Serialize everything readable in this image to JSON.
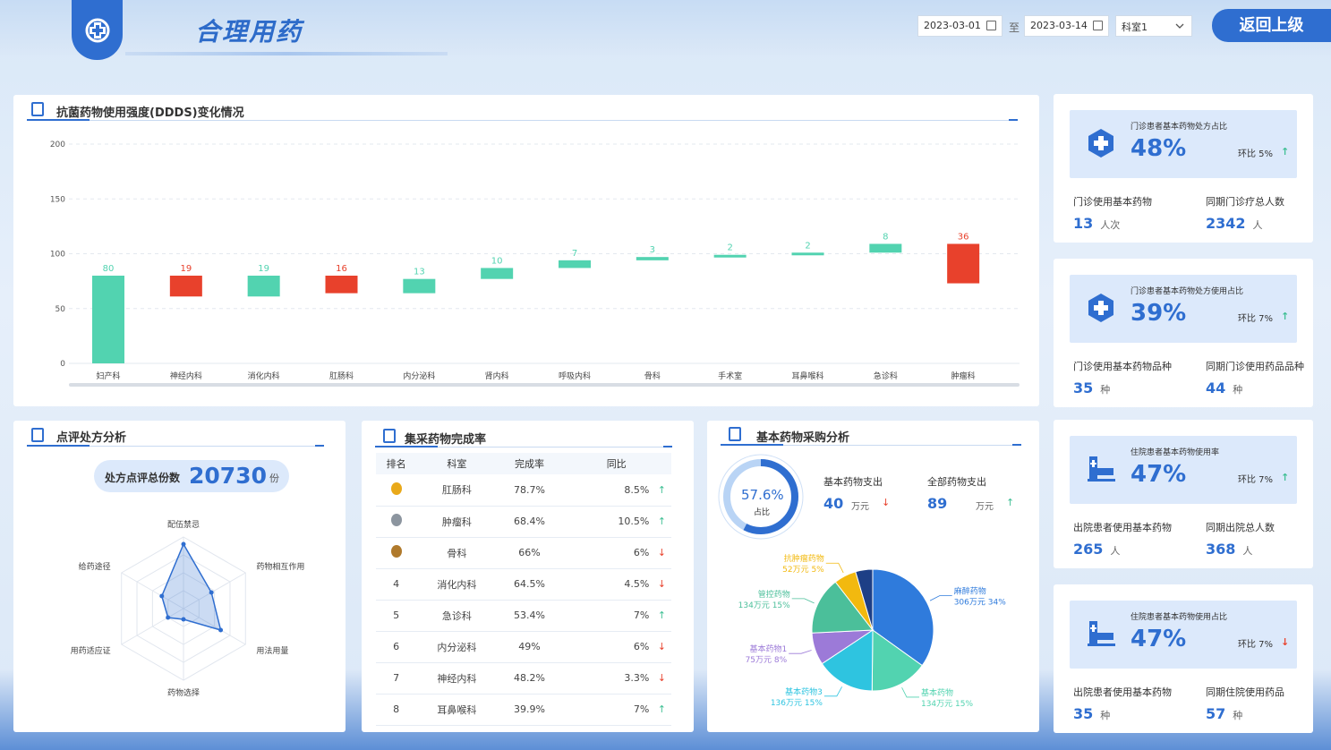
{
  "header": {
    "title": "合理用药",
    "date_start": "2023-03-01",
    "date_sep": "至",
    "date_end": "2023-03-14",
    "dept_select": "科室1",
    "back_label": "返回上级"
  },
  "colors": {
    "primary": "#2f6ed0",
    "up": "#3fbf94",
    "down": "#e8412c"
  },
  "antibiotic": {
    "title": "抗菌药物使用强度(DDDS)变化情况",
    "chart_data": {
      "type": "bar",
      "subtype": "waterfall",
      "categories": [
        "妇产科",
        "神经内科",
        "消化内科",
        "肛肠科",
        "内分泌科",
        "肾内科",
        "呼吸内科",
        "骨科",
        "手术室",
        "耳鼻喉科",
        "急诊科",
        "肿瘤科"
      ],
      "values": [
        80,
        19,
        19,
        16,
        13,
        10,
        7,
        3,
        2,
        2,
        8,
        36
      ],
      "direction": [
        "up",
        "down",
        "up",
        "down",
        "up",
        "up",
        "up",
        "up",
        "up",
        "up",
        "up",
        "down"
      ],
      "ylim": [
        0,
        200
      ],
      "yticks": [
        0,
        50,
        100,
        150,
        200
      ],
      "grid": true
    }
  },
  "review": {
    "title": "点评处方分析",
    "total_label": "处方点评总份数",
    "total_value": "20730",
    "total_unit": "份",
    "chart_data": {
      "type": "radar",
      "axes": [
        "配伍禁忌",
        "药物相互作用",
        "用法用量",
        "药物选择",
        "用药适应证",
        "给药途径"
      ],
      "values": [
        0.9,
        0.45,
        0.6,
        0.15,
        0.25,
        0.35
      ],
      "max": 1
    }
  },
  "procurement": {
    "title": "集采药物完成率",
    "columns": [
      "排名",
      "科室",
      "完成率",
      "同比"
    ],
    "rows": [
      {
        "rank": "",
        "medal": "gold",
        "dept": "肛肠科",
        "rate": "78.7%",
        "yoy": "8.5%",
        "dir": "up"
      },
      {
        "rank": "",
        "medal": "silver",
        "dept": "肿瘤科",
        "rate": "68.4%",
        "yoy": "10.5%",
        "dir": "up"
      },
      {
        "rank": "",
        "medal": "bronze",
        "dept": "骨科",
        "rate": "66%",
        "yoy": "6%",
        "dir": "down"
      },
      {
        "rank": "4",
        "medal": "",
        "dept": "消化内科",
        "rate": "64.5%",
        "yoy": "4.5%",
        "dir": "down"
      },
      {
        "rank": "5",
        "medal": "",
        "dept": "急诊科",
        "rate": "53.4%",
        "yoy": "7%",
        "dir": "up"
      },
      {
        "rank": "6",
        "medal": "",
        "dept": "内分泌科",
        "rate": "49%",
        "yoy": "6%",
        "dir": "down"
      },
      {
        "rank": "7",
        "medal": "",
        "dept": "神经内科",
        "rate": "48.2%",
        "yoy": "3.3%",
        "dir": "down"
      },
      {
        "rank": "8",
        "medal": "",
        "dept": "耳鼻喉科",
        "rate": "39.9%",
        "yoy": "7%",
        "dir": "up"
      }
    ]
  },
  "purchase": {
    "title": "基本药物采购分析",
    "ratio_value": "57.6%",
    "ratio_label": "占比",
    "ratio": 0.576,
    "basic_label": "基本药物支出",
    "basic_value": "40",
    "basic_unit": "万元",
    "all_label": "全部药物支出",
    "all_value": "89",
    "all_unit": "万元",
    "chart_data": {
      "type": "pie",
      "slices": [
        {
          "name": "麻醉药物",
          "value": 306,
          "label": "306万元  34%",
          "color": "#2f7bdc"
        },
        {
          "name": "基本药物",
          "value": 134,
          "label": "134万元  15%",
          "color": "#52d3b0"
        },
        {
          "name": "基本药物3",
          "value": 136,
          "label": "136万元  15%",
          "color": "#2ec4e0"
        },
        {
          "name": "基本药物1",
          "value": 75,
          "label": "75万元  8%",
          "color": "#9c7ad8"
        },
        {
          "name": "管控药物",
          "value": 134,
          "label": "134万元  15%",
          "color": "#4bbf9a"
        },
        {
          "name": "抗肿瘤药物",
          "value": 52,
          "label": "52万元  5%",
          "color": "#f2b90f"
        },
        {
          "name": "",
          "value": 40,
          "label": "",
          "color": "#1d3f86"
        }
      ]
    }
  },
  "kpis": [
    {
      "sub": "门诊患者基本药物处方占比",
      "big": "48%",
      "ring": "环比 5%",
      "dir": "up",
      "icon": "plus-circle-icon",
      "l1": "门诊使用基本药物",
      "v1": "13",
      "u1": "人次",
      "l2": "同期门诊疗总人数",
      "v2": "2342",
      "u2": "人"
    },
    {
      "sub": "门诊患者基本药物处方使用占比",
      "big": "39%",
      "ring": "环比 7%",
      "dir": "up",
      "icon": "plus-circle-icon",
      "l1": "门诊使用基本药物品种",
      "v1": "35",
      "u1": "种",
      "l2": "同期门诊使用药品品种",
      "v2": "44",
      "u2": "种"
    },
    {
      "sub": "住院患者基本药物使用率",
      "big": "47%",
      "ring": "环比 7%",
      "dir": "up",
      "icon": "hospital-bed-icon",
      "l1": "出院患者使用基本药物",
      "v1": "265",
      "u1": "人",
      "l2": "同期出院总人数",
      "v2": "368",
      "u2": "人"
    },
    {
      "sub": "住院患者基本药物使用占比",
      "big": "47%",
      "ring": "环比 7%",
      "dir": "down",
      "icon": "hospital-bed-icon",
      "l1": "出院患者使用基本药物",
      "v1": "35",
      "u1": "种",
      "l2": "同期住院使用药品",
      "v2": "57",
      "u2": "种"
    }
  ]
}
